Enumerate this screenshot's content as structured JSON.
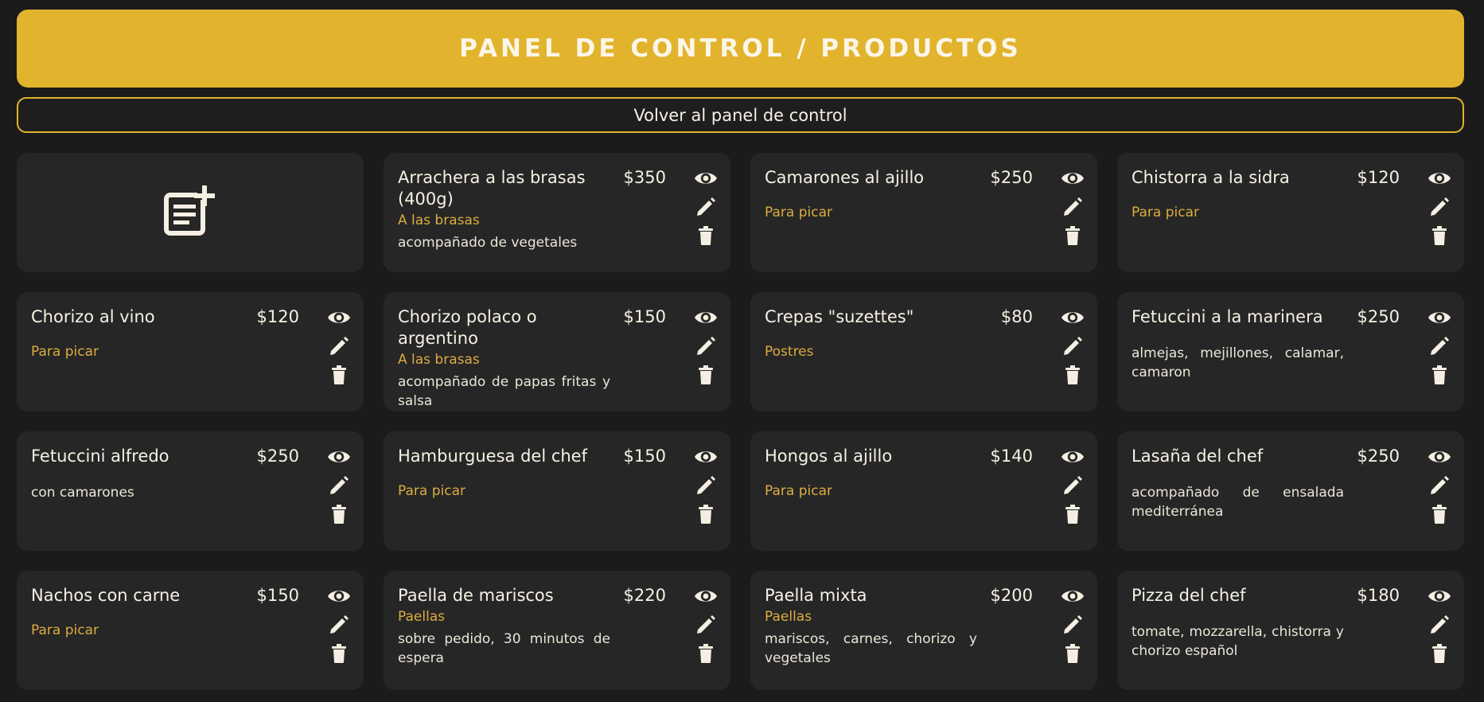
{
  "header": {
    "title": "PANEL DE CONTROL / PRODUCTOS"
  },
  "back_button": {
    "label": "Volver al panel de control"
  },
  "add_card": {
    "icon": "add-note-icon"
  },
  "colors": {
    "accent": "#e2b32c",
    "category": "#dcac3e",
    "card_bg": "#262626",
    "page_bg": "#1b1b1b"
  },
  "products": [
    {
      "name": "Arrachera a las brasas (400g)",
      "price": "$350",
      "category": "A las brasas",
      "description": "acompañado de vegetales"
    },
    {
      "name": "Camarones al ajillo",
      "price": "$250",
      "category": "Para picar",
      "description": ""
    },
    {
      "name": "Chistorra a la sidra",
      "price": "$120",
      "category": "Para picar",
      "description": ""
    },
    {
      "name": "Chorizo al vino",
      "price": "$120",
      "category": "Para picar",
      "description": ""
    },
    {
      "name": "Chorizo polaco o argentino",
      "price": "$150",
      "category": "A las brasas",
      "description": "acompañado de papas fritas y salsa"
    },
    {
      "name": "Crepas \"suzettes\"",
      "price": "$80",
      "category": "Postres",
      "description": ""
    },
    {
      "name": "Fetuccini a la marinera",
      "price": "$250",
      "category": "",
      "description": "almejas, mejillones, calamar, camaron"
    },
    {
      "name": "Fetuccini alfredo",
      "price": "$250",
      "category": "",
      "description": "con camarones"
    },
    {
      "name": "Hamburguesa del chef",
      "price": "$150",
      "category": "Para picar",
      "description": ""
    },
    {
      "name": "Hongos al ajillo",
      "price": "$140",
      "category": "Para picar",
      "description": ""
    },
    {
      "name": "Lasaña del chef",
      "price": "$250",
      "category": "",
      "description": "acompañado de ensalada mediterránea"
    },
    {
      "name": "Nachos con carne",
      "price": "$150",
      "category": "Para picar",
      "description": ""
    },
    {
      "name": "Paella de mariscos",
      "price": "$220",
      "category": "Paellas",
      "description": "sobre pedido, 30 minutos de espera"
    },
    {
      "name": "Paella mixta",
      "price": "$200",
      "category": "Paellas",
      "description": "mariscos, carnes, chorizo y vegetales"
    },
    {
      "name": "Pizza del chef",
      "price": "$180",
      "category": "",
      "description": "tomate, mozzarella, chistorra y chorizo español"
    }
  ]
}
